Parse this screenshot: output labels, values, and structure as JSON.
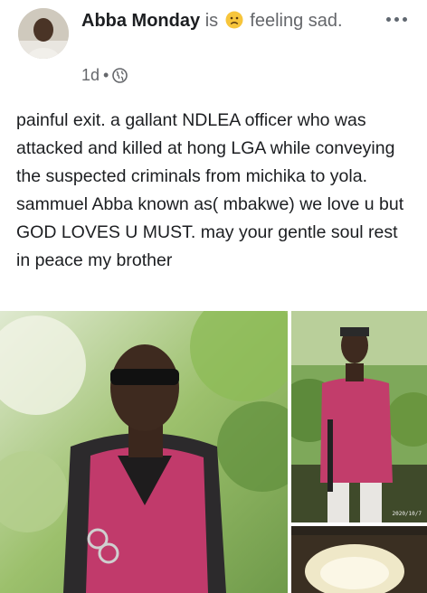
{
  "post": {
    "author_name": "Abba Monday",
    "feeling_prefix": "is",
    "feeling_emoji": "sad-face-icon",
    "feeling_verb": "feeling",
    "feeling_word": "sad.",
    "timestamp": "1d",
    "meta_separator": "•",
    "privacy_icon": "globe-icon",
    "more_icon": "more-options-icon",
    "body_text": "painful exit. a gallant NDLEA officer who was attacked and killed at hong LGA while conveying the suspected criminals from michika to yola. sammuel Abba known as( mbakwe) we love u but GOD LOVES U MUST. may your gentle soul rest in peace my brother"
  },
  "photos": {
    "photo_2_stamp": "2020/10/7"
  },
  "colors": {
    "text": "#1c1e21",
    "muted": "#65676b",
    "vest": "#c0396a",
    "foliage": "#7ea85a"
  }
}
